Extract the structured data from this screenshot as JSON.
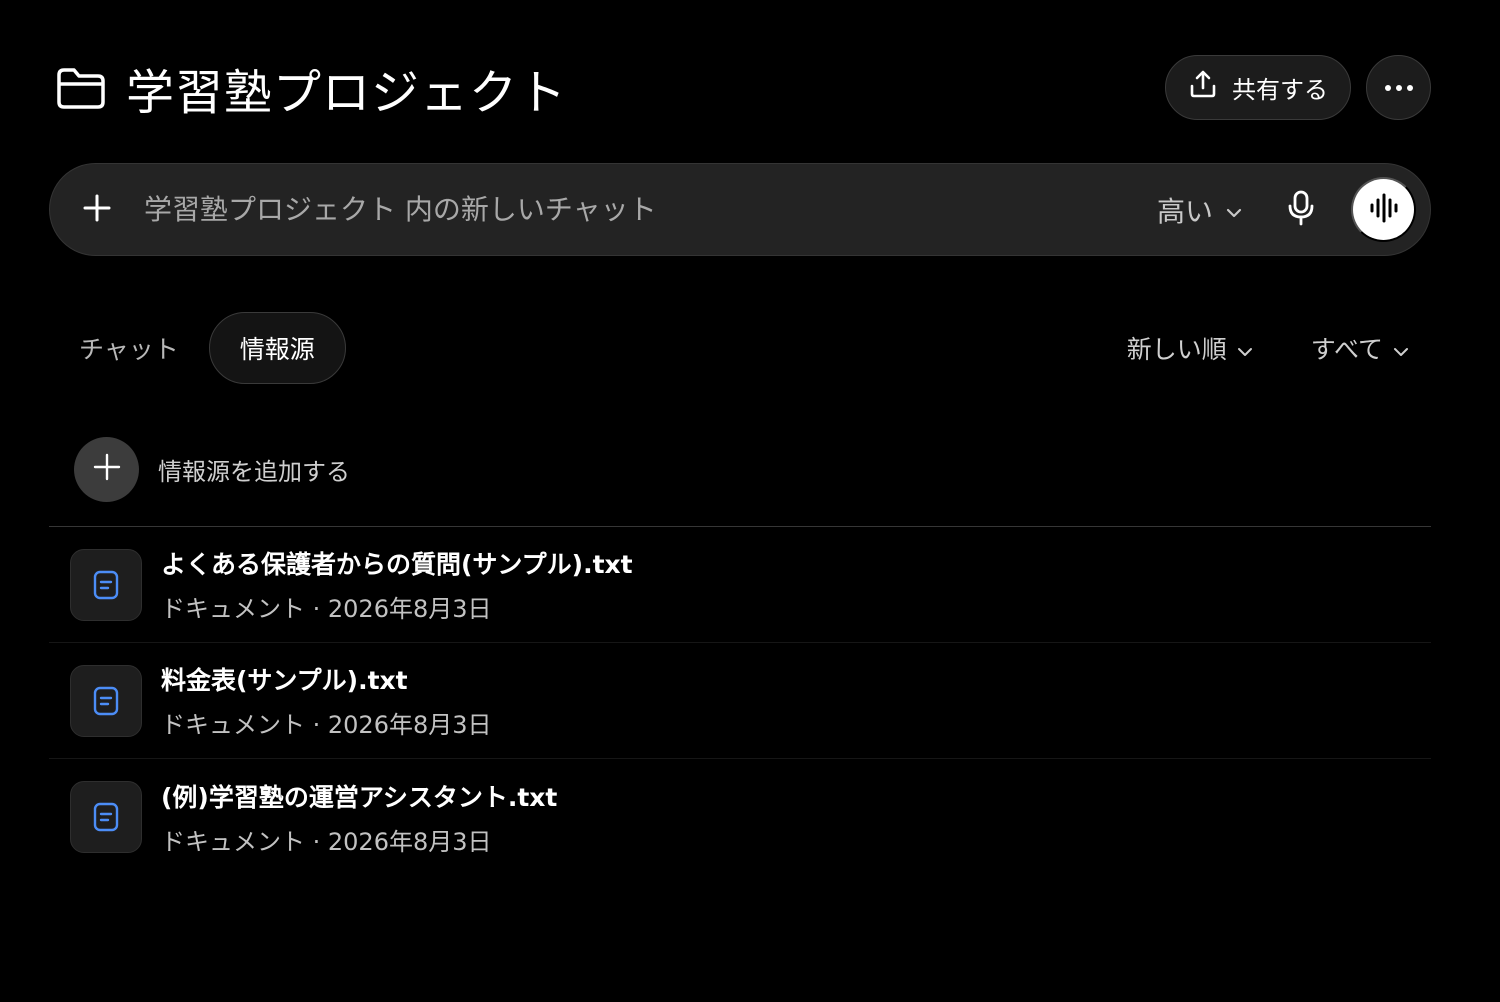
{
  "header": {
    "title": "学習塾プロジェクト",
    "share_label": "共有する"
  },
  "composer": {
    "placeholder": "学習塾プロジェクト 内の新しいチャット",
    "effort_label": "高い"
  },
  "tabs": [
    {
      "label": "チャット",
      "active": false
    },
    {
      "label": "情報源",
      "active": true
    }
  ],
  "filters": {
    "sort_label": "新しい順",
    "type_label": "すべて"
  },
  "add_source": {
    "label": "情報源を追加する"
  },
  "files": [
    {
      "name": "よくある保護者からの質問(サンプル).txt",
      "meta": "ドキュメント · 2026年8月3日"
    },
    {
      "name": "料金表(サンプル).txt",
      "meta": "ドキュメント · 2026年8月3日"
    },
    {
      "name": "(例)学習塾の運営アシスタント.txt",
      "meta": "ドキュメント · 2026年8月3日"
    }
  ],
  "colors": {
    "background": "#000000",
    "surface": "#232323",
    "file_icon": "#4c8df6"
  },
  "icons": {
    "title": "folder-icon",
    "share": "upload-icon",
    "more": "ellipsis-icon",
    "composer_add": "plus-icon",
    "mic": "microphone-icon",
    "voice": "voice-wave-icon",
    "file": "document-icon"
  }
}
